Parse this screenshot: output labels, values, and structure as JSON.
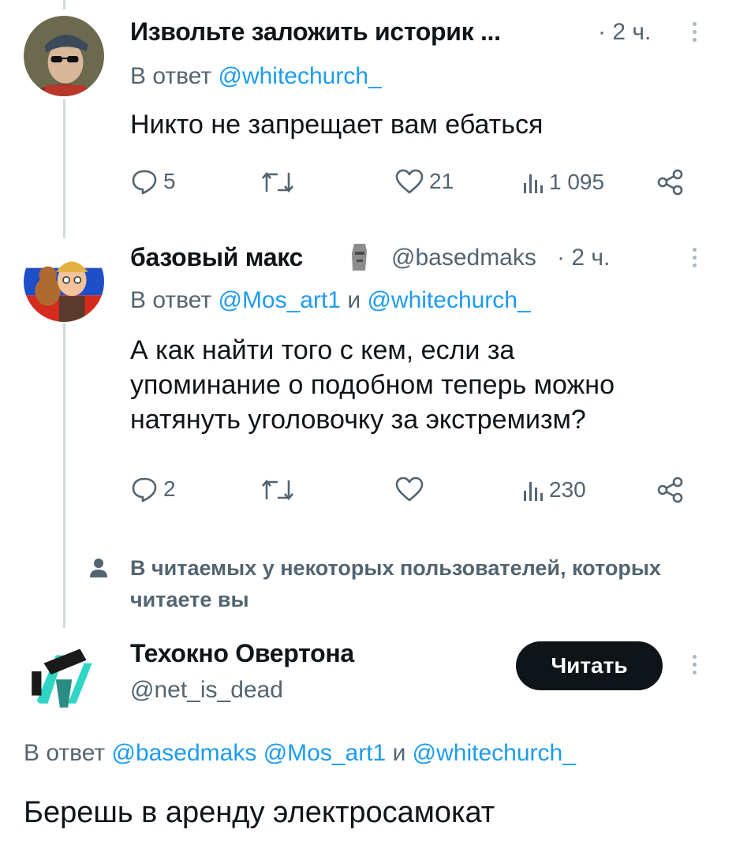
{
  "tweets": [
    {
      "author_name": "Извольте заложить историк ...",
      "time": "· 2 ч.",
      "reply_label": "В ответ",
      "reply_to": [
        "@whitechurch_"
      ],
      "text": "Никто не запрещает вам ебаться",
      "replies": "5",
      "retweets": "",
      "likes": "21",
      "views": "1 095"
    },
    {
      "author_name": "базовый макс",
      "author_handle": "@basedmaks",
      "time": "· 2 ч.",
      "reply_label": "В ответ",
      "reply_to_first": "@Mos_art1",
      "reply_conj": "и",
      "reply_to_second": "@whitechurch_",
      "text_lines": [
        "А как найти того с кем, если за",
        "упоминание о подобном теперь можно",
        "натянуть уголовочку за экстремизм?"
      ],
      "replies": "2",
      "retweets": "",
      "likes": "",
      "views": "230"
    }
  ],
  "social_context": "В читаемых у некоторых пользователей, которых читаете вы",
  "suggested_user": {
    "name": "Техокно Овертона",
    "handle": "@net_is_dead",
    "follow_label": "Читать"
  },
  "last_tweet": {
    "reply_label": "В ответ",
    "reply_to_first": "@basedmaks",
    "reply_to_second": "@Mos_art1",
    "reply_conj": "и",
    "reply_to_third": "@whitechurch_",
    "text": "Берешь в аренду электросамокат"
  },
  "icons": {
    "reply": "speech-bubble-icon",
    "retweet": "retweet-icon",
    "like": "heart-icon",
    "views": "bar-chart-icon",
    "share": "share-icon",
    "more": "vertical-ellipsis-icon",
    "context": "person-icon"
  },
  "colors": {
    "link": "#1d9bf0",
    "secondary": "#536471",
    "button": "#0f1419"
  }
}
